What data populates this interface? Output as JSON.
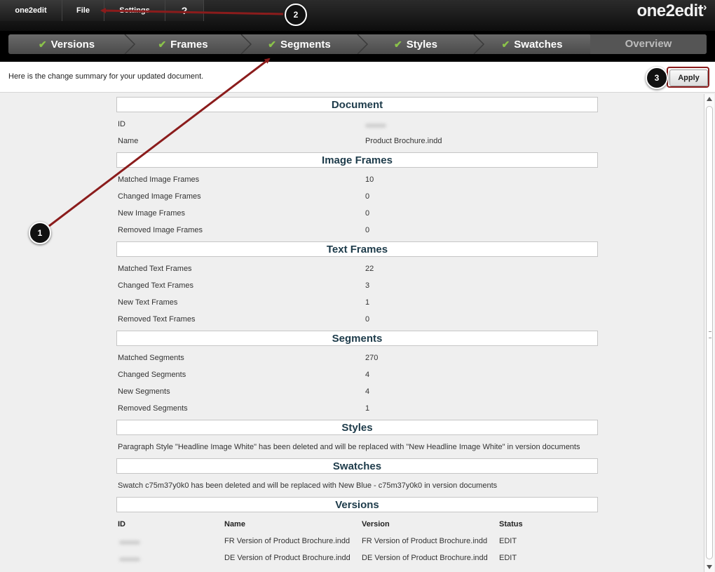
{
  "menu": {
    "app": "one2edit",
    "file": "File",
    "settings": "Settings",
    "help_icon": "question-circle-icon",
    "logo": "one2edit"
  },
  "steps": [
    {
      "label": "Versions",
      "done": true
    },
    {
      "label": "Frames",
      "done": true
    },
    {
      "label": "Segments",
      "done": true
    },
    {
      "label": "Styles",
      "done": true
    },
    {
      "label": "Swatches",
      "done": true
    },
    {
      "label": "Overview",
      "done": false
    }
  ],
  "message": "Here is the change summary for your updated document.",
  "apply_label": "Apply",
  "document": {
    "title": "Document",
    "id_label": "ID",
    "name_label": "Name",
    "name_value": "Product Brochure.indd"
  },
  "image_frames": {
    "title": "Image Frames",
    "rows": [
      {
        "label": "Matched Image Frames",
        "value": "10"
      },
      {
        "label": "Changed Image Frames",
        "value": "0"
      },
      {
        "label": "New Image Frames",
        "value": "0"
      },
      {
        "label": "Removed Image Frames",
        "value": "0"
      }
    ]
  },
  "text_frames": {
    "title": "Text Frames",
    "rows": [
      {
        "label": "Matched Text Frames",
        "value": "22"
      },
      {
        "label": "Changed Text Frames",
        "value": "3"
      },
      {
        "label": "New Text Frames",
        "value": "1"
      },
      {
        "label": "Removed Text Frames",
        "value": "0"
      }
    ]
  },
  "segments": {
    "title": "Segments",
    "rows": [
      {
        "label": "Matched Segments",
        "value": "270"
      },
      {
        "label": "Changed Segments",
        "value": "4"
      },
      {
        "label": "New Segments",
        "value": "4"
      },
      {
        "label": "Removed Segments",
        "value": "1"
      }
    ]
  },
  "styles": {
    "title": "Styles",
    "text": "Paragraph Style \"Headline Image White\" has been deleted and will be replaced with \"New Headline Image White\" in version documents"
  },
  "swatches": {
    "title": "Swatches",
    "text": "Swatch c75m37y0k0 has been deleted and will be replaced with New Blue - c75m37y0k0 in version documents"
  },
  "versions": {
    "title": "Versions",
    "columns": [
      "ID",
      "Name",
      "Version",
      "Status"
    ],
    "rows": [
      {
        "name": "FR Version of Product Brochure.indd",
        "version": "FR Version of Product Brochure.indd",
        "status": "EDIT"
      },
      {
        "name": "DE Version of Product Brochure.indd",
        "version": "DE Version of Product Brochure.indd",
        "status": "EDIT"
      }
    ]
  },
  "callouts": [
    "1",
    "2",
    "3"
  ],
  "colors": {
    "check": "#8bc34a",
    "annotation": "#8b1c1c",
    "section_title": "#1d3b4a"
  }
}
